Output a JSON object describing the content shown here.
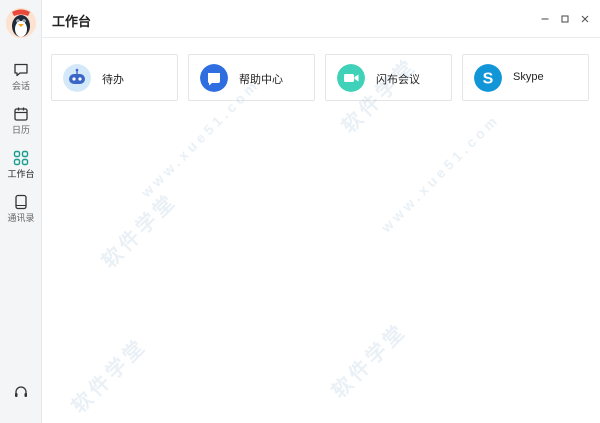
{
  "header": {
    "title": "工作台"
  },
  "sidebar": {
    "items": [
      {
        "label": "会话",
        "icon": "chat-bubble-icon"
      },
      {
        "label": "日历",
        "icon": "calendar-icon"
      },
      {
        "label": "工作台",
        "icon": "grid-icon",
        "active": true
      },
      {
        "label": "通讯录",
        "icon": "contacts-icon"
      }
    ]
  },
  "cards": [
    {
      "label": "待办",
      "icon": "robot-todo-icon",
      "color": "#cfe6f7"
    },
    {
      "label": "帮助中心",
      "icon": "help-chat-icon",
      "color": "#2f6ee0"
    },
    {
      "label": "闪布会议",
      "icon": "video-camera-icon",
      "color": "#3fd2b8"
    },
    {
      "label": "Skype",
      "icon": "skype-icon",
      "color": "#1296d8"
    }
  ],
  "watermark": {
    "text": "软件学堂",
    "site": "www.xue51.com"
  },
  "colors": {
    "accent": "#1a9e8f",
    "sidebar_bg": "#f4f5f7"
  }
}
